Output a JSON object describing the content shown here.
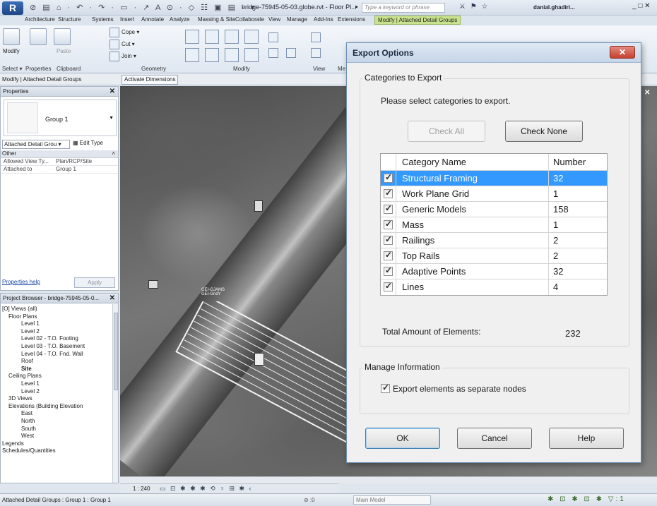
{
  "titlebar": {
    "logo": "R",
    "title": "bridge-75945-05-03.globe.rvt - Floor Pl...",
    "search_placeholder": "Type a keyword or phrase",
    "user": "danial.ghadiri...",
    "quick_access": "⊘ ▤ ⌂ · ↶ · ↷ · ▭ · ↗ A ⊙ · ◇ ☷ ▣ ▤ · ▾"
  },
  "ribbon": {
    "tabs": [
      "Architecture",
      "Structure",
      "Systems",
      "Insert",
      "Annotate",
      "Analyze",
      "Massing & Site",
      "Collaborate",
      "View",
      "Manage",
      "Add-Ins",
      "Extensions",
      "Modify | Attached Detail Groups"
    ],
    "group_labels": [
      "Select ▾",
      "Properties",
      "Clipboard",
      "Geometry",
      "Modify",
      "View",
      "Me"
    ],
    "modify_label": "Modify",
    "paste_label": "Paste",
    "cope_label": "Cope ▾",
    "cut_label": "Cut ▾",
    "join_label": "Join ▾"
  },
  "context": {
    "label": "Modify | Attached Detail Groups",
    "activate_dimensions": "Activate Dimensions"
  },
  "properties": {
    "title": "Properties",
    "type_name": "Group 1",
    "instance_filter": "Attached Detail Grou ▾",
    "edit_type": "Edit Type",
    "category": "Other",
    "rows": [
      {
        "name": "Allowed View Ty...",
        "value": "Plan/RCP/Site"
      },
      {
        "name": "Attached to",
        "value": "Group 1"
      }
    ],
    "help_link": "Properties help",
    "apply": "Apply"
  },
  "project_browser": {
    "title": "Project Browser - bridge-75945-05-0...",
    "nodes": [
      {
        "label": "[O] Views (all)",
        "indent": 0,
        "bold": false
      },
      {
        "label": "Floor Plans",
        "indent": 1,
        "bold": false
      },
      {
        "label": "Level 1",
        "indent": 3,
        "bold": false
      },
      {
        "label": "Level 2",
        "indent": 3,
        "bold": false
      },
      {
        "label": "Level 02 - T.O. Footing",
        "indent": 3,
        "bold": false
      },
      {
        "label": "Level 03 - T.O. Basement",
        "indent": 3,
        "bold": false
      },
      {
        "label": "Level 04 - T.O. Fnd. Wall",
        "indent": 3,
        "bold": false
      },
      {
        "label": "Roof",
        "indent": 3,
        "bold": false
      },
      {
        "label": "Site",
        "indent": 3,
        "bold": true
      },
      {
        "label": "Ceiling Plans",
        "indent": 1,
        "bold": false
      },
      {
        "label": "Level 1",
        "indent": 3,
        "bold": false
      },
      {
        "label": "Level 2",
        "indent": 3,
        "bold": false
      },
      {
        "label": "3D Views",
        "indent": 1,
        "bold": false
      },
      {
        "label": "Elevations (Building Elevation",
        "indent": 1,
        "bold": false
      },
      {
        "label": "East",
        "indent": 3,
        "bold": false
      },
      {
        "label": "North",
        "indent": 3,
        "bold": false
      },
      {
        "label": "South",
        "indent": 3,
        "bold": false
      },
      {
        "label": "West",
        "indent": 3,
        "bold": false
      },
      {
        "label": "Legends",
        "indent": 0,
        "bold": false
      },
      {
        "label": "Schedules/Quantities",
        "indent": 0,
        "bold": false
      }
    ]
  },
  "canvas": {
    "tag_text_1": "GEI-GJAMS",
    "tag_text_2": "GEI-GridY"
  },
  "view_bar": {
    "scale": "1 : 240",
    "icons": "▭ ⊡ ✱ ✱ ✱ ⟲ ♀ ⊞ ✱ ‹"
  },
  "status": {
    "text": "Attached Detail Groups : Group 1 : Group 1",
    "workset": "⊘ :0",
    "model": "Main Model",
    "icons": "✱ ⊡ ✱ ⊡ ✱ ▽:1"
  },
  "dialog": {
    "title": "Export Options",
    "close_glyph": "✕",
    "categories_legend": "Categories to Export",
    "instruction": "Please select categories to export.",
    "check_all": "Check All",
    "check_none": "Check None",
    "col_name": "Category Name",
    "col_number": "Number",
    "rows": [
      {
        "name": "Structural Framing",
        "number": "32",
        "checked": true,
        "selected": true
      },
      {
        "name": "Work Plane Grid",
        "number": "1",
        "checked": true,
        "selected": false
      },
      {
        "name": "Generic Models",
        "number": "158",
        "checked": true,
        "selected": false
      },
      {
        "name": "Mass",
        "number": "1",
        "checked": true,
        "selected": false
      },
      {
        "name": "Railings",
        "number": "2",
        "checked": true,
        "selected": false
      },
      {
        "name": "Top Rails",
        "number": "2",
        "checked": true,
        "selected": false
      },
      {
        "name": "Adaptive Points",
        "number": "32",
        "checked": true,
        "selected": false
      },
      {
        "name": "Lines",
        "number": "4",
        "checked": true,
        "selected": false
      }
    ],
    "total_label": "Total Amount of Elements:",
    "total_value": "232",
    "manage_legend": "Manage Information",
    "export_separate": "Export elements as separate nodes",
    "ok": "OK",
    "cancel": "Cancel",
    "help": "Help"
  }
}
